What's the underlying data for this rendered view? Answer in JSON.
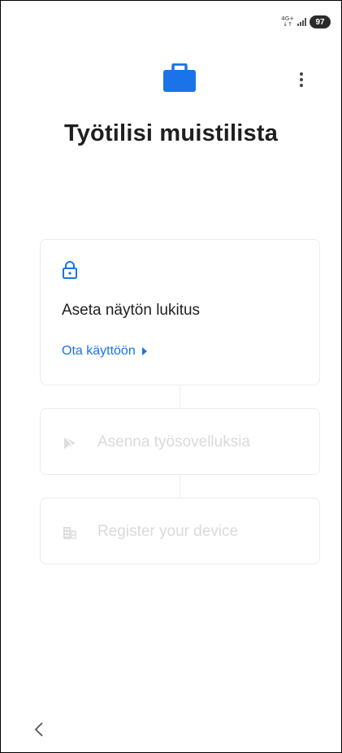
{
  "status_bar": {
    "network_top": "4G+",
    "network_bottom": "↓↑",
    "battery": "97"
  },
  "header": {
    "title": "Työtilisi muistilista",
    "icon": "briefcase-icon",
    "menu_icon": "more-vert-icon"
  },
  "checklist": {
    "screen_lock": {
      "icon": "lock-icon",
      "title": "Aseta näytön lukitus",
      "action_label": "Ota käyttöön"
    },
    "install_apps": {
      "icon": "play-store-icon",
      "title": "Asenna työsovelluksia"
    },
    "register_device": {
      "icon": "building-icon",
      "title": "Register your device"
    }
  },
  "nav": {
    "back_icon": "back-chevron-icon"
  },
  "colors": {
    "accent": "#1a73e8",
    "disabled_text": "#dadada",
    "card_border": "#ececec"
  }
}
